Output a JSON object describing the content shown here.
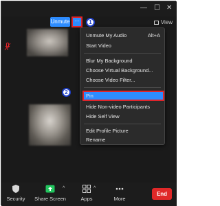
{
  "window": {
    "minimize_glyph": "—",
    "maximize_glyph": "☐",
    "close_glyph": "✕"
  },
  "controls": {
    "unmute_label": "Unmute",
    "more_label": "···",
    "view_label": "View"
  },
  "steps": {
    "step1": "1",
    "step2": "2"
  },
  "menu": {
    "items": [
      {
        "label": "Unmute My Audio",
        "shortcut": "Alt+A"
      },
      {
        "label": "Start Video"
      },
      {
        "label": "Blur My Background"
      },
      {
        "label": "Choose Virtual Background..."
      },
      {
        "label": "Choose Video Filter..."
      },
      {
        "label": "Pin"
      },
      {
        "label": "Hide Non-video Participants"
      },
      {
        "label": "Hide Self View"
      },
      {
        "label": "Edit Profile Picture"
      },
      {
        "label": "Rename"
      }
    ],
    "highlighted_item": "Pin",
    "highlight_color": "#2d8cff",
    "callout_color": "#e0242a"
  },
  "toolbar": {
    "security_label": "Security",
    "share_label": "Share Screen",
    "apps_label": "Apps",
    "more_label": "More",
    "end_label": "End",
    "share_color": "#22c55e",
    "end_color": "#e02828",
    "caret_glyph": "^"
  },
  "icons": [
    "muted-mic-icon",
    "shield-icon",
    "share-screen-icon",
    "apps-icon",
    "more-dots-icon",
    "view-grid-icon"
  ]
}
